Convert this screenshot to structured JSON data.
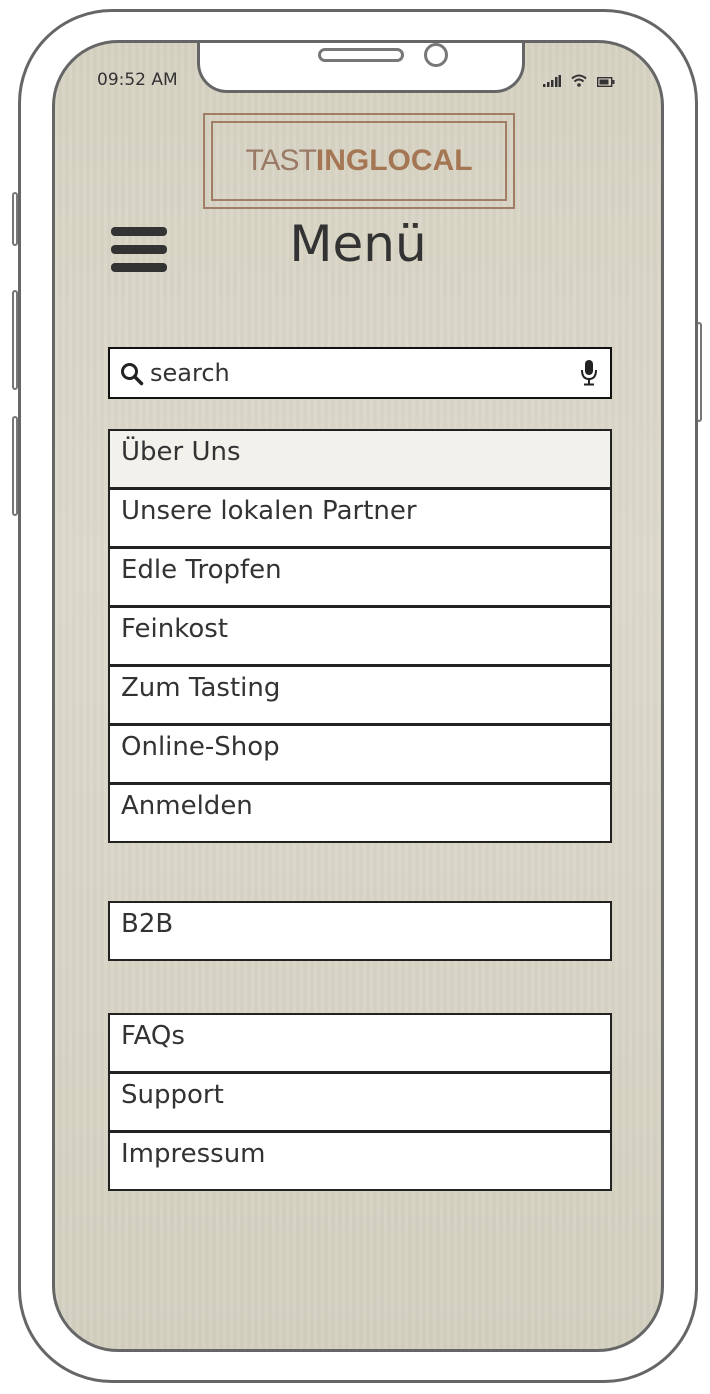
{
  "status_bar": {
    "time": "09:52 AM"
  },
  "logo": {
    "part1": "TAST",
    "part2": "INGLOCAL"
  },
  "header": {
    "title": "Menü"
  },
  "search": {
    "placeholder": "search"
  },
  "menu_main": [
    {
      "label": "Über Uns",
      "active": true
    },
    {
      "label": "Unsere lokalen Partner"
    },
    {
      "label": "Edle Tropfen"
    },
    {
      "label": "Feinkost"
    },
    {
      "label": "Zum Tasting"
    },
    {
      "label": "Online-Shop"
    },
    {
      "label": "Anmelden"
    }
  ],
  "menu_b2b": [
    {
      "label": "B2B"
    }
  ],
  "menu_info": [
    {
      "label": "FAQs"
    },
    {
      "label": "Support"
    },
    {
      "label": "Impressum"
    }
  ],
  "colors": {
    "logo_accent": "#a47654",
    "text": "#333333",
    "background": "#d8d5c6"
  },
  "icons": [
    "search-icon",
    "microphone-icon",
    "hamburger-menu-icon",
    "signal-icon",
    "wifi-icon",
    "battery-icon"
  ]
}
